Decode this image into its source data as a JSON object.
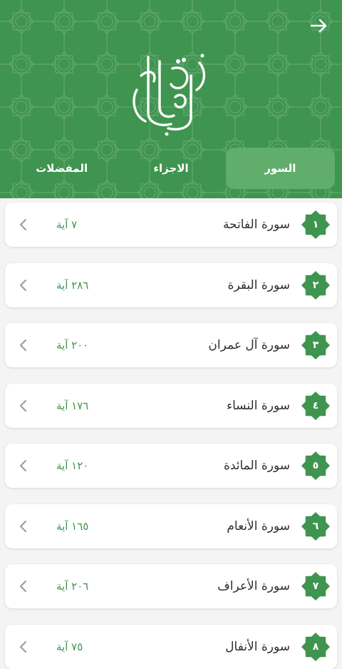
{
  "header": {
    "logo_text": "القرآن الكريم",
    "colors": {
      "primary": "#3f944f",
      "active_tab": "#60ad6c"
    }
  },
  "tabs": [
    {
      "label": "السور",
      "active": true
    },
    {
      "label": "الاجزاء",
      "active": false
    },
    {
      "label": "المفضلات",
      "active": false
    }
  ],
  "surahs": [
    {
      "number": "١",
      "name": "سورة الفاتحة",
      "ayat": "٧ آية"
    },
    {
      "number": "٢",
      "name": "سورة البقرة",
      "ayat": "٢٨٦ آية"
    },
    {
      "number": "٣",
      "name": "سورة آل عمران",
      "ayat": "٢٠٠ آية"
    },
    {
      "number": "٤",
      "name": "سورة النساء",
      "ayat": "١٧٦ آية"
    },
    {
      "number": "٥",
      "name": "سورة المائدة",
      "ayat": "١٢٠ آية"
    },
    {
      "number": "٦",
      "name": "سورة الأنعام",
      "ayat": "١٦٥ آية"
    },
    {
      "number": "٧",
      "name": "سورة الأعراف",
      "ayat": "٢٠٦ آية"
    },
    {
      "number": "٨",
      "name": "سورة الأنفال",
      "ayat": "٧٥ آية"
    }
  ]
}
